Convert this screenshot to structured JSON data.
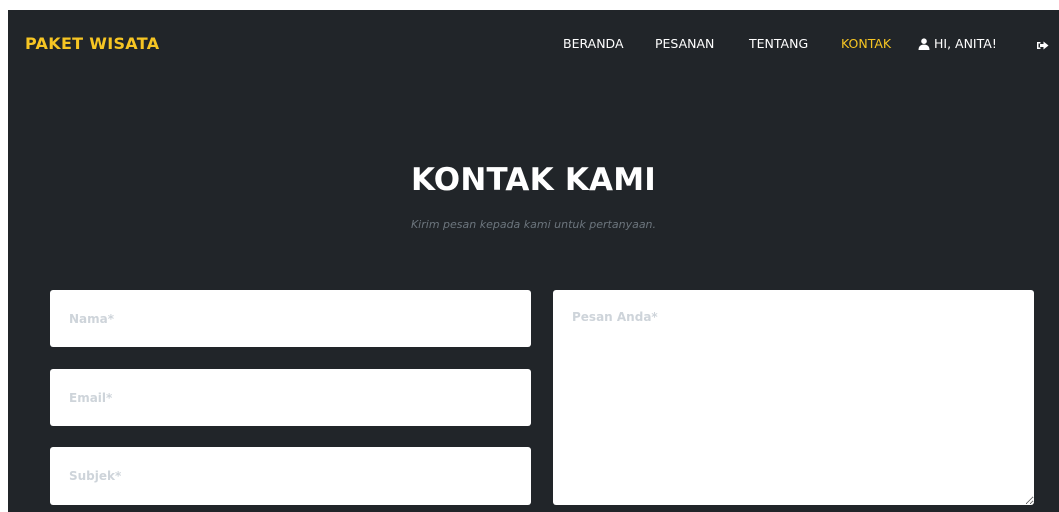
{
  "navbar": {
    "brand": "PAKET WISATA",
    "items": [
      {
        "label": "BERANDA"
      },
      {
        "label": "PESANAN"
      },
      {
        "label": "TENTANG"
      },
      {
        "label": "KONTAK",
        "active": true
      }
    ],
    "user_label": "HI, ANITA!",
    "user_icon": "user-icon",
    "logout_icon": "sign-out-icon"
  },
  "hero": {
    "title": "KONTAK KAMI",
    "subtitle": "Kirim pesan kepada kami untuk pertanyaan."
  },
  "form": {
    "name_placeholder": "Nama*",
    "email_placeholder": "Email*",
    "subject_placeholder": "Subjek*",
    "message_placeholder": "Pesan Anda*",
    "name_value": "",
    "email_value": "",
    "subject_value": "",
    "message_value": ""
  },
  "colors": {
    "background": "#212529",
    "accent": "#f6c523",
    "text": "#ffffff",
    "muted": "#6c757d"
  }
}
